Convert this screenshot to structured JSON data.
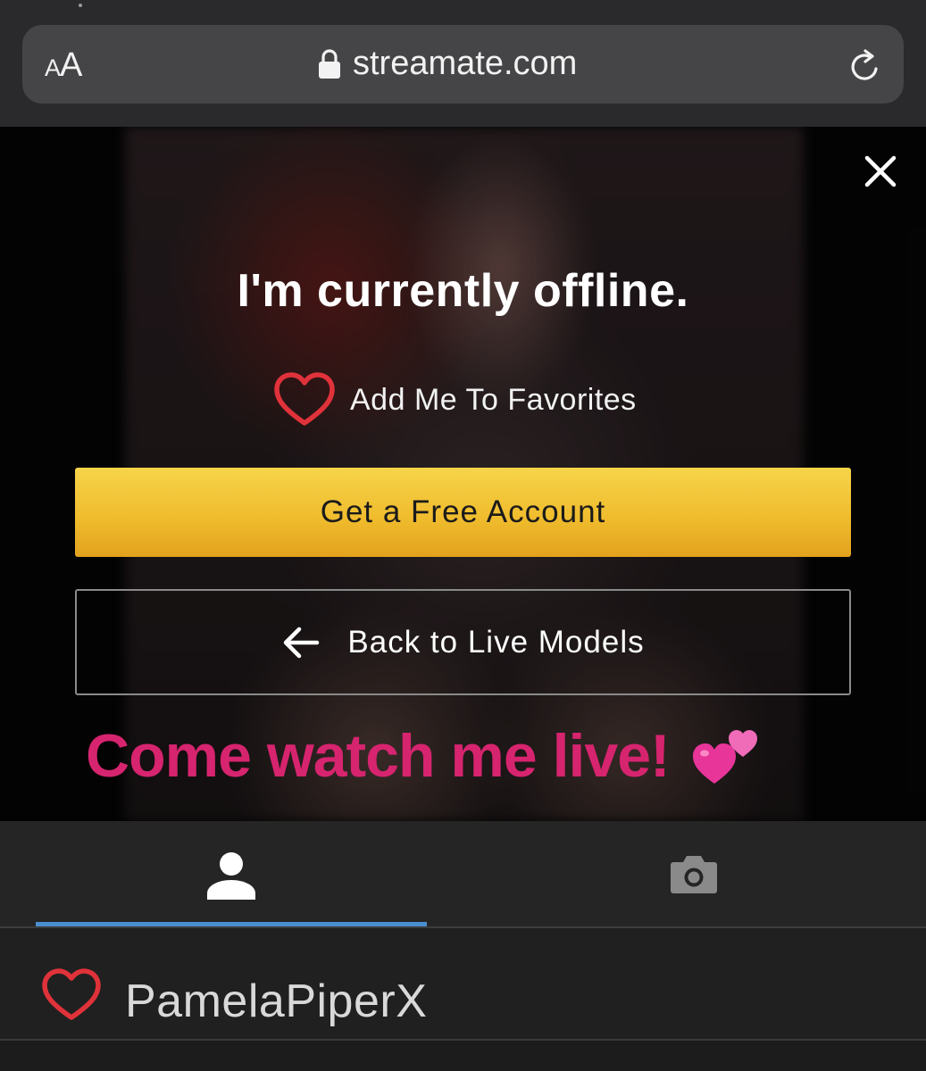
{
  "browser": {
    "text_size_small": "A",
    "text_size_large": "A",
    "url": "streamate.com"
  },
  "offline_panel": {
    "title": "I'm currently offline.",
    "favorites_label": "Add Me To Favorites",
    "cta_label": "Get a Free Account",
    "back_label": "Back to Live Models",
    "promo_text": "Come watch me live!"
  },
  "tabs": {
    "items": [
      {
        "name": "profile",
        "icon": "person-icon",
        "active": true
      },
      {
        "name": "photos",
        "icon": "camera-icon",
        "active": false
      }
    ]
  },
  "model": {
    "name": "PamelaPiperX"
  },
  "colors": {
    "accent_yellow": "#f0bd2e",
    "promo_pink": "#d6246f",
    "heart_red": "#e0323a",
    "tab_active": "#4a8fd1"
  }
}
